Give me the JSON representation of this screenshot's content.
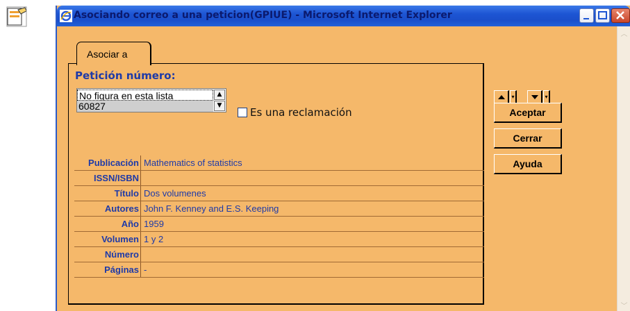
{
  "window": {
    "title": "Asociando correo a una peticion(GPIUE) - Microsoft Internet Explorer",
    "bg_color": "#f5b86a",
    "title_color": "#0b1a6e"
  },
  "tab": {
    "label": "Asociar a"
  },
  "peticion": {
    "label": "Petición número:",
    "options": [
      "No figura en esta lista",
      "60827"
    ],
    "selected": "60827"
  },
  "reclamacion": {
    "label": "Es una reclamación",
    "checked": false
  },
  "fields": [
    {
      "label": "Publicación",
      "value": "Mathematics of statistics"
    },
    {
      "label": "ISSN/ISBN",
      "value": ""
    },
    {
      "label": "Título",
      "value": "Dos volumenes"
    },
    {
      "label": "Autores",
      "value": "John F. Kenney and E.S. Keeping"
    },
    {
      "label": "Año",
      "value": "1959"
    },
    {
      "label": "Volumen",
      "value": "1 y 2"
    },
    {
      "label": "Número",
      "value": ""
    },
    {
      "label": "Páginas",
      "value": "-"
    }
  ],
  "actions": {
    "accept": "Aceptar",
    "close": "Cerrar",
    "help": "Ayuda"
  },
  "icons": {
    "app": "form-icon",
    "ie": "internet-explorer-icon",
    "up": "arrow-up-icon",
    "down": "arrow-down-icon"
  }
}
